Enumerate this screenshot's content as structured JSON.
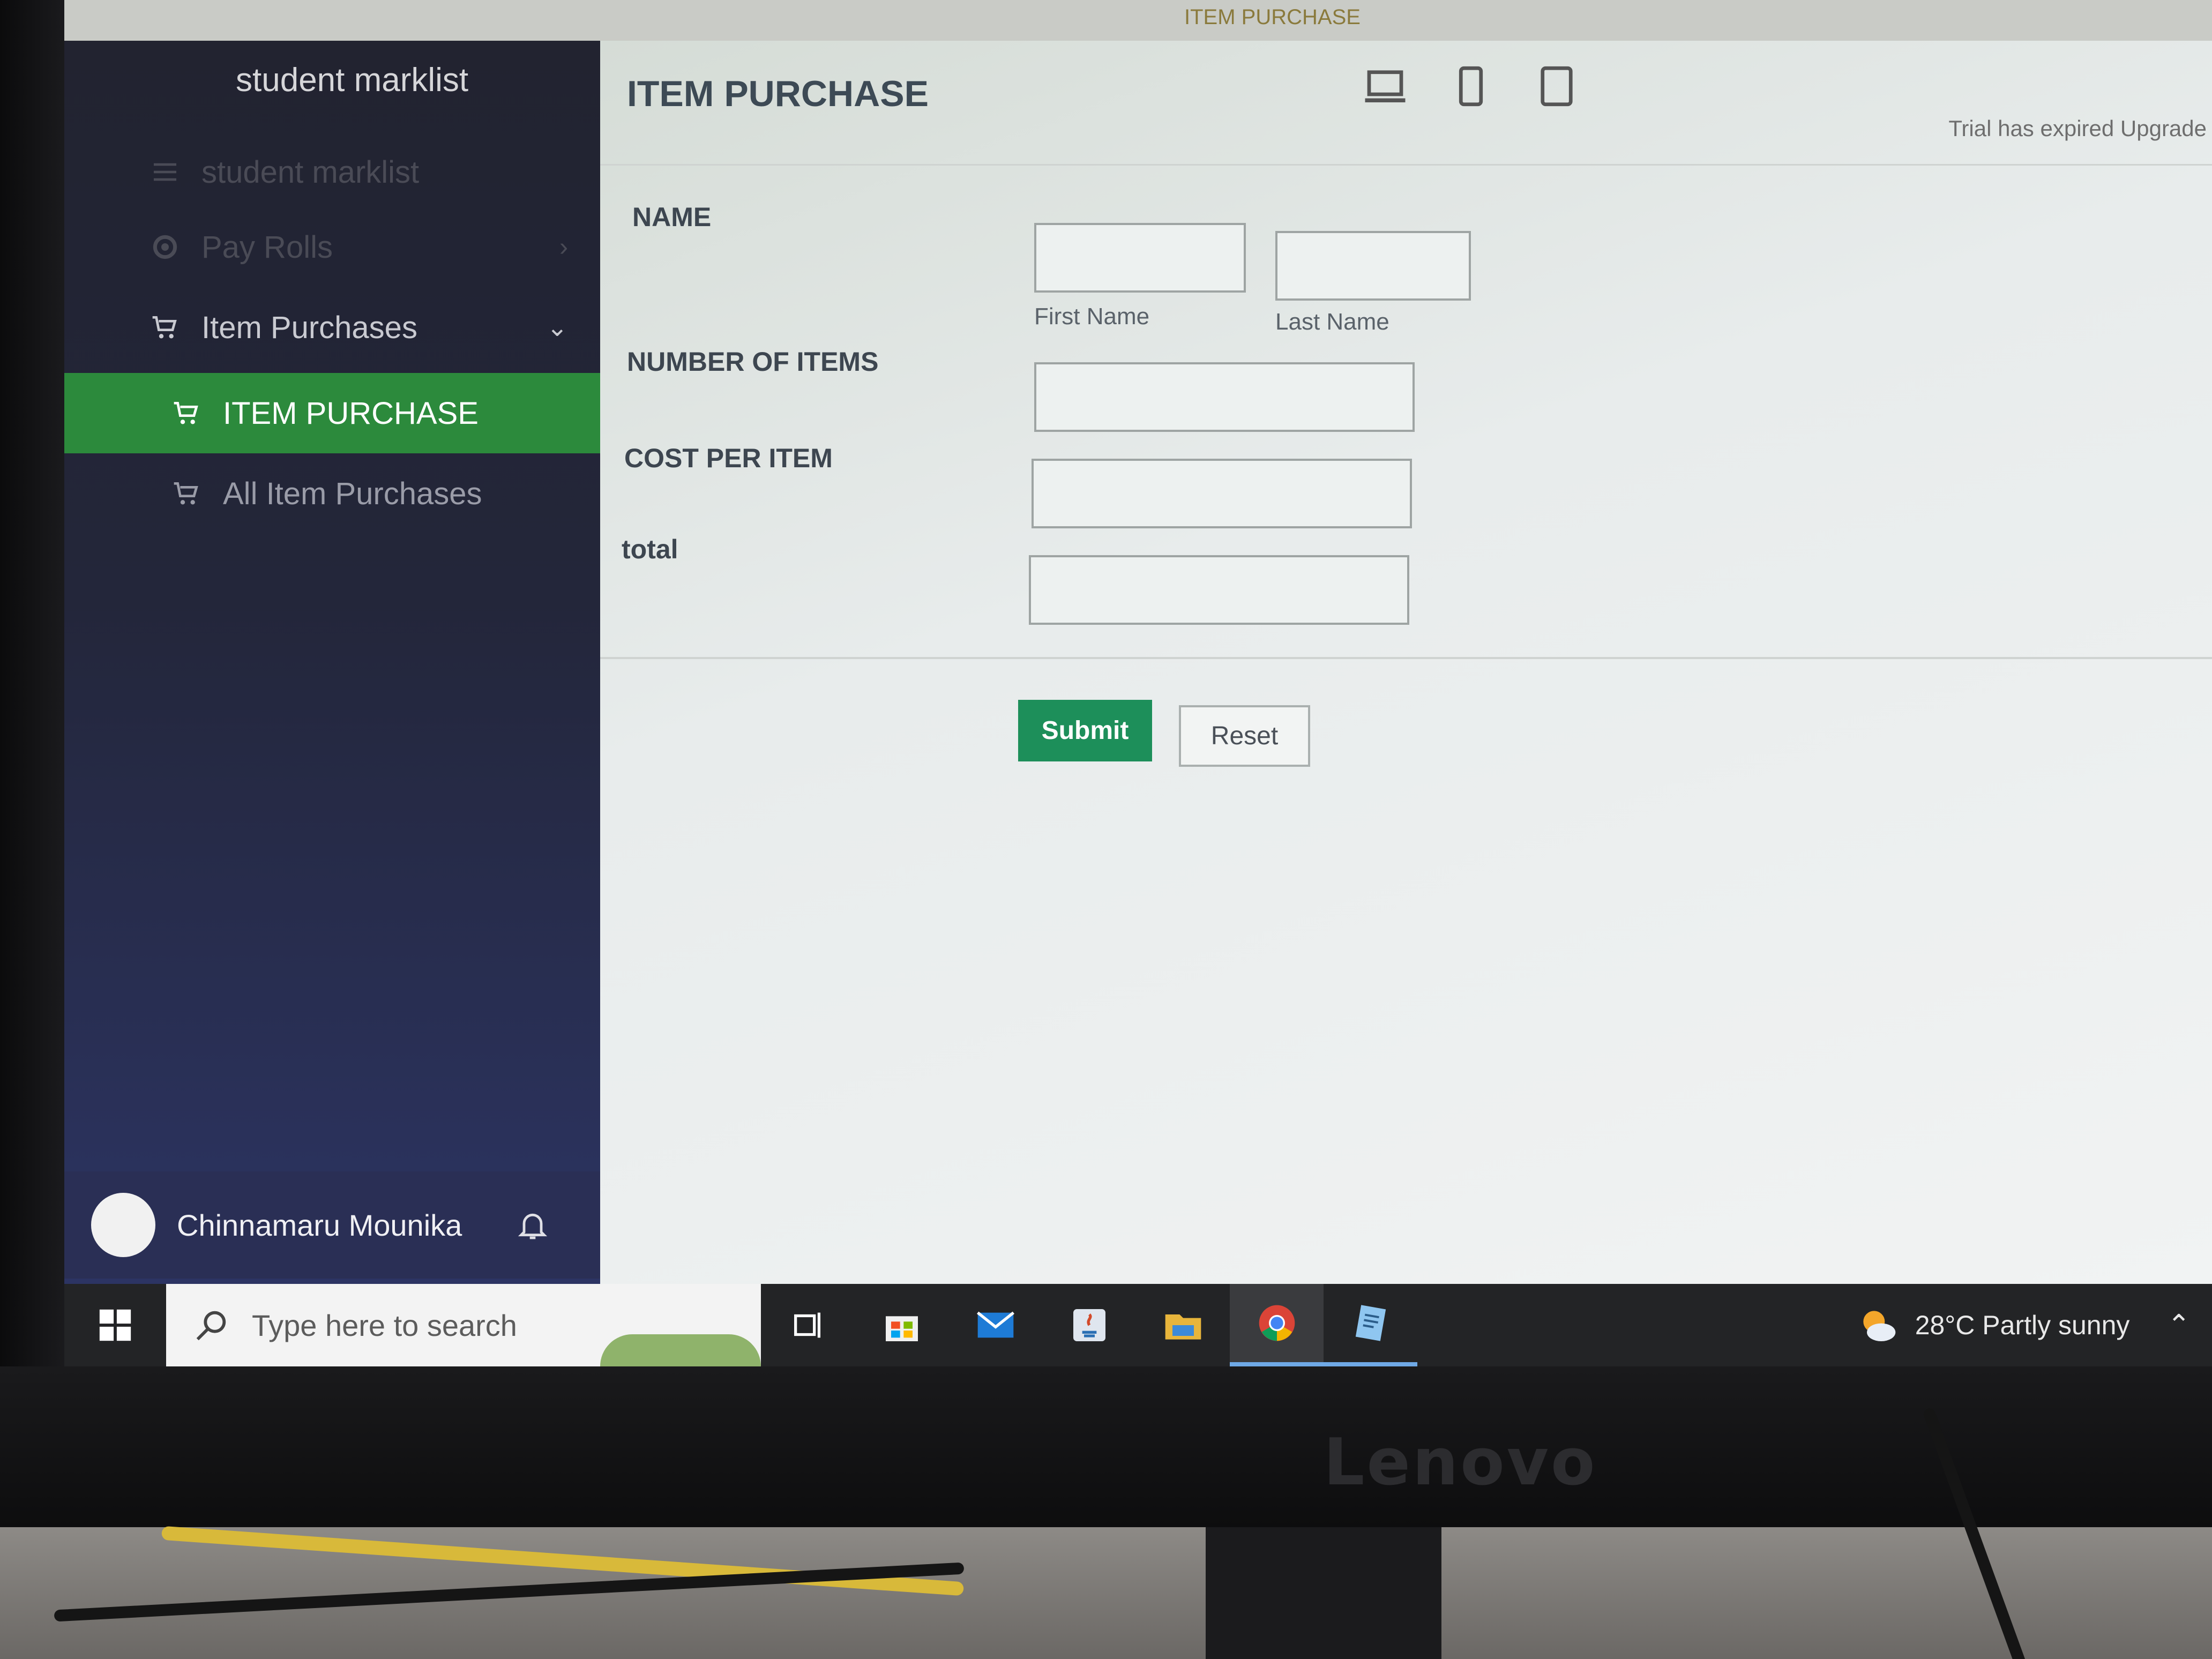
{
  "window": {
    "tab_fragment": "ITEM PURCHASE"
  },
  "sidebar": {
    "app_title": "student marklist",
    "items": [
      {
        "label": "student marklist",
        "state": "faded"
      },
      {
        "label": "Pay Rolls",
        "state": "faded"
      },
      {
        "label": "Item Purchases",
        "state": "expanded"
      },
      {
        "label": "ITEM PURCHASE",
        "state": "active"
      },
      {
        "label": "All Item Purchases",
        "state": "sub"
      }
    ],
    "user_name": "Chinnamaru Mounika"
  },
  "main": {
    "page_title": "ITEM PURCHASE",
    "trial_notice": "Trial has expired Upgrade",
    "form": {
      "name_label": "NAME",
      "first_name_caption": "First Name",
      "last_name_caption": "Last Name",
      "first_name_value": "",
      "last_name_value": "",
      "items_label": "NUMBER OF ITEMS",
      "items_value": "",
      "cost_label": "COST PER ITEM",
      "cost_value": "",
      "total_label": "total",
      "total_value": "",
      "submit_label": "Submit",
      "reset_label": "Reset"
    }
  },
  "taskbar": {
    "search_placeholder": "Type here to search",
    "weather": "28°C  Partly sunny",
    "apps": [
      "task-view-icon",
      "store-icon",
      "mail-icon",
      "java-icon",
      "file-explorer-icon",
      "chrome-icon",
      "notepad-icon"
    ]
  },
  "monitor": {
    "brand": "Lenovo"
  },
  "colors": {
    "active_green": "#2c8a3c",
    "submit_green": "#1d8f5a",
    "sidebar_dark": "#23263a"
  }
}
